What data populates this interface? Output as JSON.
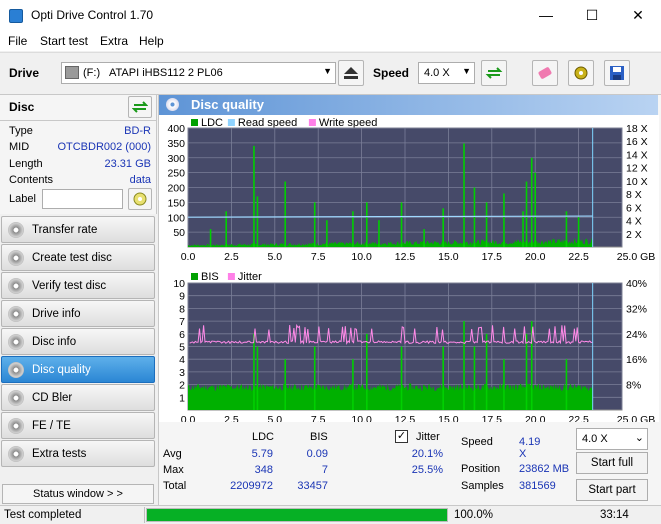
{
  "app": {
    "title": "Opti Drive Control 1.70",
    "minimize": "—",
    "maximize": "☐",
    "close": "✕"
  },
  "menu": [
    "File",
    "Start test",
    "Extra",
    "Help"
  ],
  "toolbar": {
    "drive_label": "Drive",
    "drive_letter": "(F:)",
    "drive_name": "ATAPI iHBS112   2 PL06",
    "speed_label": "Speed",
    "speed_value": "4.0 X"
  },
  "disc": {
    "header": "Disc",
    "rows": [
      {
        "label": "Type",
        "value": "BD-R"
      },
      {
        "label": "MID",
        "value": "OTCBDR002 (000)"
      },
      {
        "label": "Length",
        "value": "23.31 GB"
      },
      {
        "label": "Contents",
        "value": "data"
      }
    ],
    "label_field": "Label",
    "label_value": ""
  },
  "nav": [
    {
      "label": "Transfer rate",
      "active": false
    },
    {
      "label": "Create test disc",
      "active": false
    },
    {
      "label": "Verify test disc",
      "active": false
    },
    {
      "label": "Drive info",
      "active": false
    },
    {
      "label": "Disc info",
      "active": false
    },
    {
      "label": "Disc quality",
      "active": true
    },
    {
      "label": "CD Bler",
      "active": false
    },
    {
      "label": "FE / TE",
      "active": false
    },
    {
      "label": "Extra tests",
      "active": false
    }
  ],
  "status_window": "Status window > >",
  "panel_title": "Disc quality",
  "chart_data": [
    {
      "type": "line",
      "legend": [
        "LDC",
        "Read speed",
        "Write speed"
      ],
      "colors": {
        "LDC": "#00a000",
        "Read speed": "#8fd3ff",
        "Write speed": "#ff80e8"
      },
      "x_ticks": [
        "0.0",
        "2.5",
        "5.0",
        "7.5",
        "10.0",
        "12.5",
        "15.0",
        "17.5",
        "20.0",
        "22.5",
        "25.0 GB"
      ],
      "y_left_ticks": [
        "400",
        "350",
        "300",
        "250",
        "200",
        "150",
        "100",
        "50"
      ],
      "y_right_ticks": [
        "18 X",
        "16 X",
        "14 X",
        "12 X",
        "10 X",
        "8 X",
        "6 X",
        "4 X",
        "2 X"
      ],
      "xlim": [
        0,
        25
      ],
      "ylim": [
        0,
        400
      ],
      "ldc_baseline": 20,
      "ldc_spikes": [
        [
          1.3,
          60
        ],
        [
          2.2,
          120
        ],
        [
          3.8,
          340
        ],
        [
          4.0,
          170
        ],
        [
          5.6,
          220
        ],
        [
          7.3,
          150
        ],
        [
          8.0,
          90
        ],
        [
          9.5,
          120
        ],
        [
          10.3,
          150
        ],
        [
          11.0,
          90
        ],
        [
          12.3,
          150
        ],
        [
          13.6,
          60
        ],
        [
          14.7,
          130
        ],
        [
          15.9,
          348
        ],
        [
          16.5,
          200
        ],
        [
          17.2,
          150
        ],
        [
          18.2,
          180
        ],
        [
          19.3,
          120
        ],
        [
          19.5,
          220
        ],
        [
          19.8,
          300
        ],
        [
          20.0,
          250
        ],
        [
          21.8,
          120
        ],
        [
          22.5,
          100
        ]
      ],
      "read_speed": [
        [
          0,
          4.0
        ],
        [
          23.3,
          4.19
        ]
      ]
    },
    {
      "type": "line",
      "legend": [
        "BIS",
        "Jitter"
      ],
      "colors": {
        "BIS": "#00a000",
        "Jitter": "#ff80e8"
      },
      "x_ticks": [
        "0.0",
        "2.5",
        "5.0",
        "7.5",
        "10.0",
        "12.5",
        "15.0",
        "17.5",
        "20.0",
        "22.5",
        "25.0 GB"
      ],
      "y_left_ticks": [
        "10",
        "9",
        "8",
        "7",
        "6",
        "5",
        "4",
        "3",
        "2",
        "1"
      ],
      "y_right_ticks": [
        "40%",
        "32%",
        "24%",
        "16%",
        "8%"
      ],
      "xlim": [
        0,
        25
      ],
      "ylim": [
        0,
        10
      ],
      "bis_baseline": 2,
      "bis_spikes": [
        [
          3.8,
          6
        ],
        [
          4.0,
          5
        ],
        [
          5.6,
          4
        ],
        [
          7.3,
          5
        ],
        [
          9.5,
          4
        ],
        [
          10.3,
          6
        ],
        [
          12.3,
          5
        ],
        [
          14.7,
          5
        ],
        [
          15.9,
          7
        ],
        [
          16.5,
          5
        ],
        [
          17.2,
          6
        ],
        [
          18.2,
          4
        ],
        [
          19.5,
          6
        ],
        [
          19.8,
          7
        ],
        [
          21.8,
          4
        ]
      ],
      "jitter_base": 20.1
    }
  ],
  "stats": {
    "col_ldc": "LDC",
    "col_bis": "BIS",
    "rows": [
      {
        "label": "Avg",
        "ldc": "5.79",
        "bis": "0.09",
        "jitter": "20.1%"
      },
      {
        "label": "Max",
        "ldc": "348",
        "bis": "7",
        "jitter": "25.5%"
      },
      {
        "label": "Total",
        "ldc": "2209972",
        "bis": "33457",
        "jitter": ""
      }
    ],
    "jitter_label": "Jitter",
    "jitter_checked": true,
    "speed_label": "Speed",
    "speed_value": "4.19 X",
    "position_label": "Position",
    "position_value": "23862 MB",
    "samples_label": "Samples",
    "samples_value": "381569",
    "speed_select": "4.0 X",
    "start_full": "Start full",
    "start_part": "Start part"
  },
  "statusbar": {
    "text": "Test completed",
    "progress": 1.0,
    "progress_text": "100.0%",
    "time": "33:14"
  }
}
